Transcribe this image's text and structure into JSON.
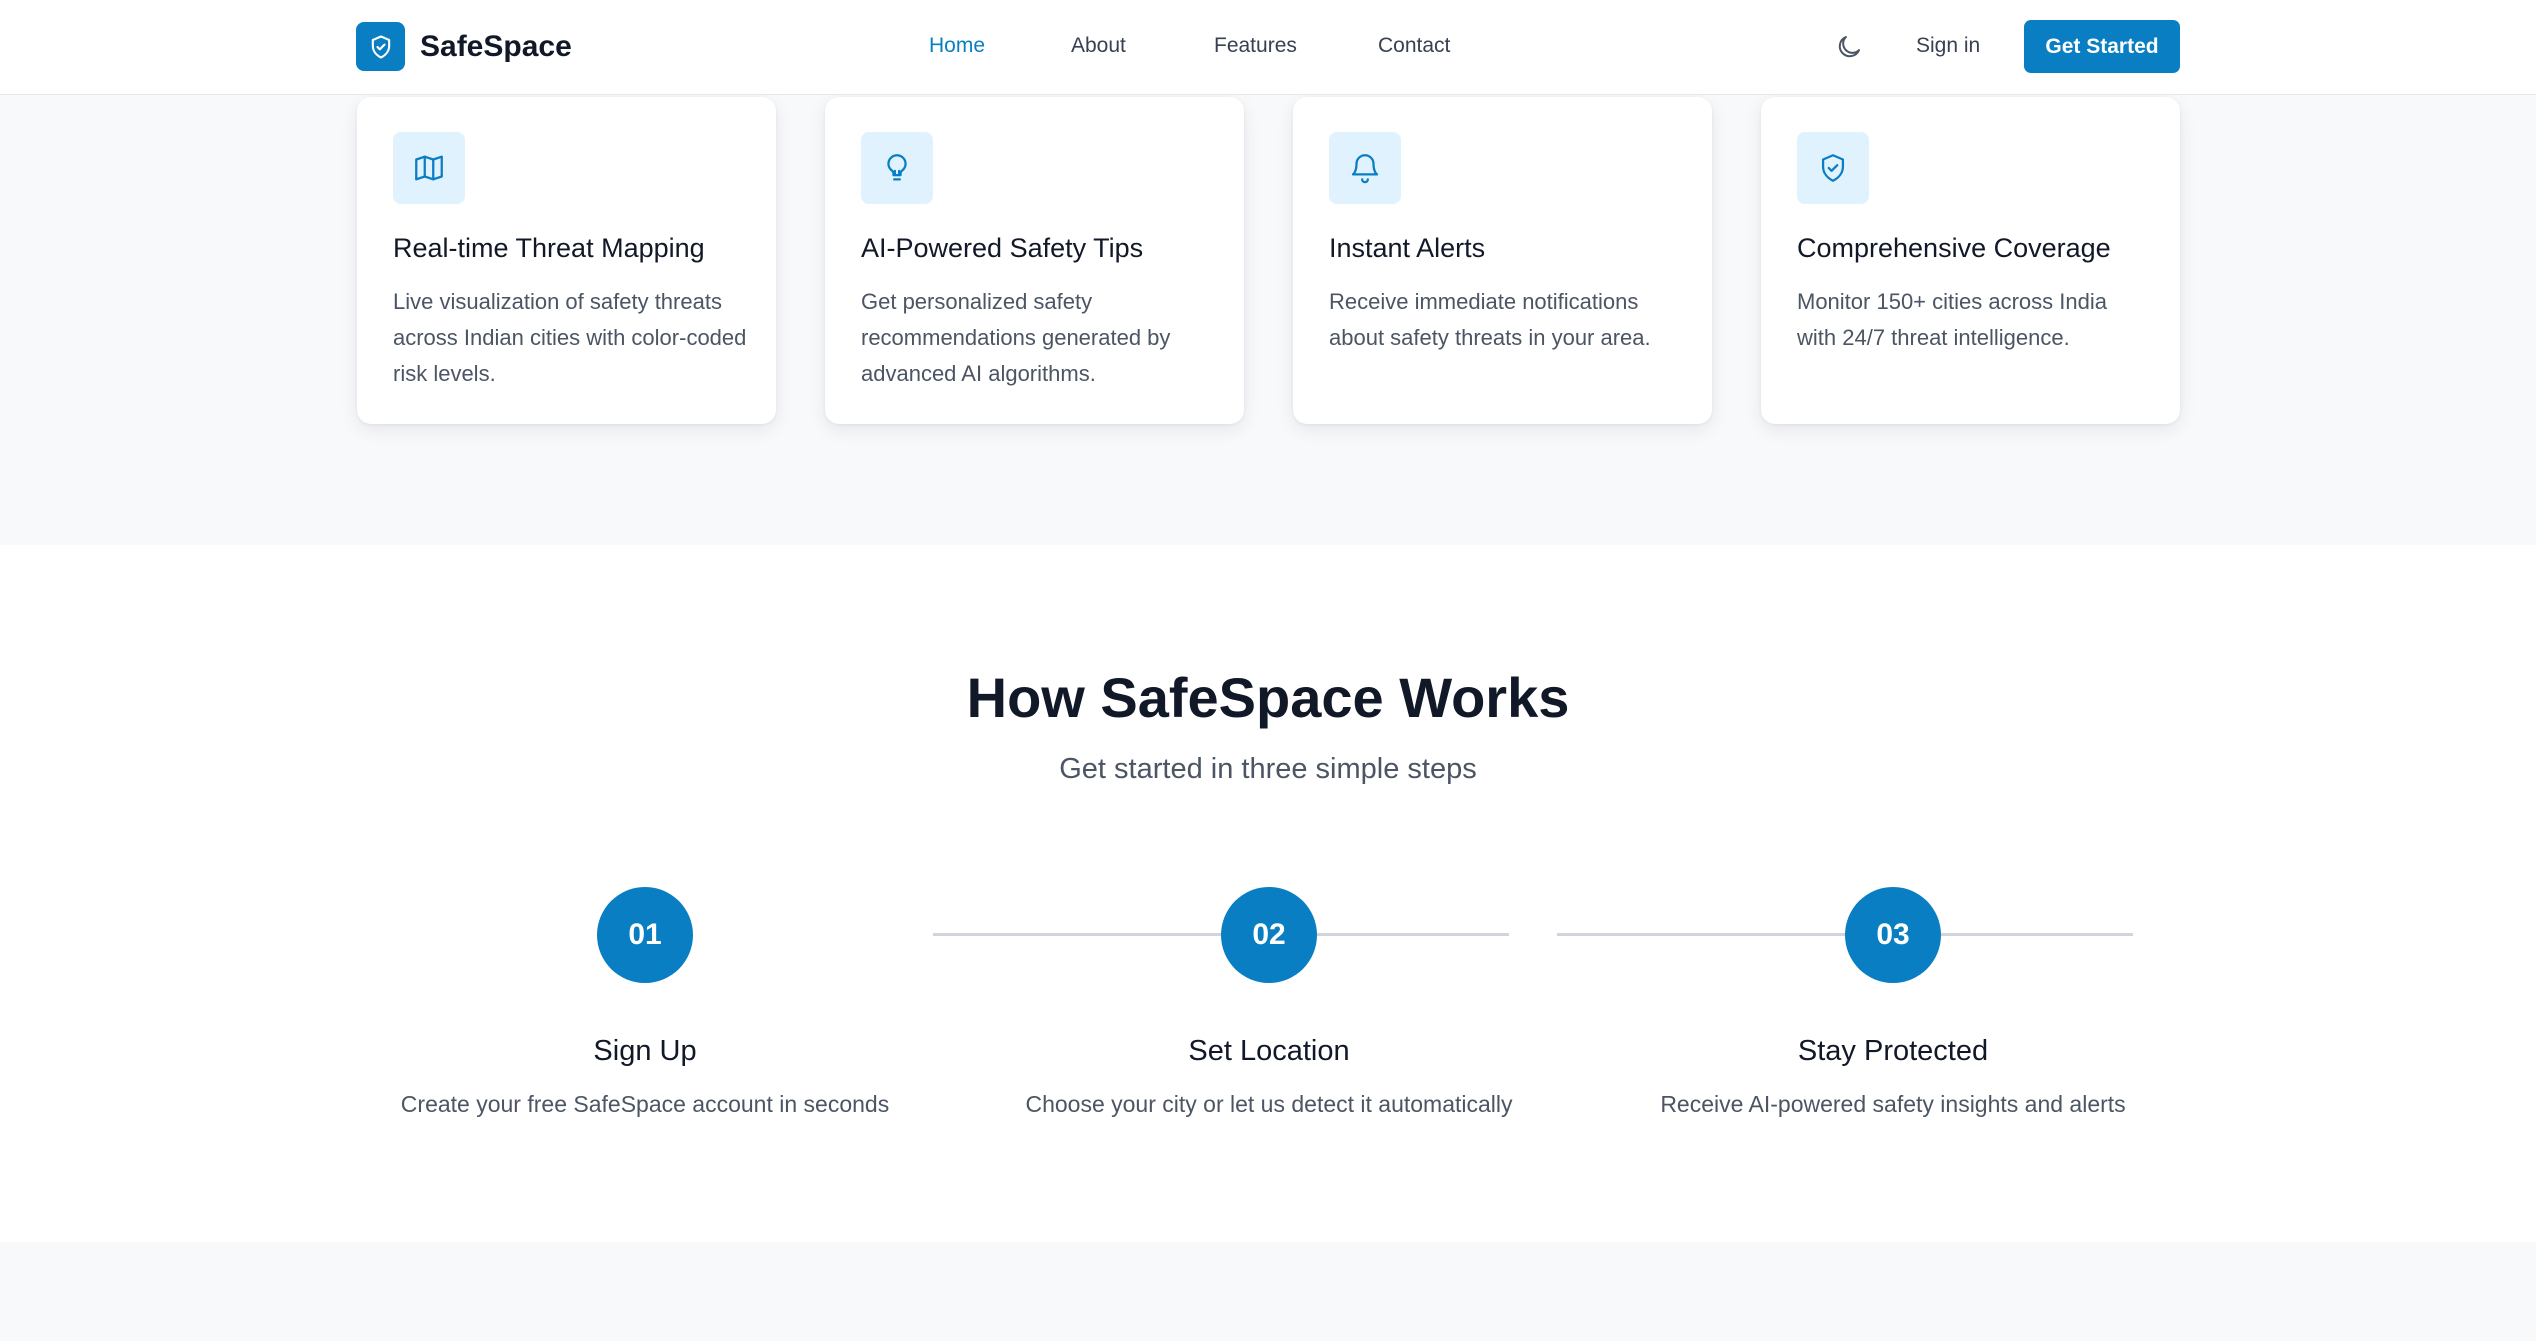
{
  "header": {
    "brand": "SafeSpace",
    "nav": [
      "Home",
      "About",
      "Features",
      "Contact"
    ],
    "active_nav": "Home",
    "theme_icon": "moon-icon",
    "sign_in": "Sign in",
    "get_started": "Get Started"
  },
  "features": [
    {
      "icon": "map-icon",
      "title": "Real-time Threat Mapping",
      "description": "Live visualization of safety threats across Indian cities with color-coded risk levels."
    },
    {
      "icon": "lightbulb-icon",
      "title": "AI-Powered Safety Tips",
      "description": "Get personalized safety recommendations generated by advanced AI algorithms."
    },
    {
      "icon": "bell-icon",
      "title": "Instant Alerts",
      "description": "Receive immediate notifications about safety threats in your area."
    },
    {
      "icon": "shield-check-icon",
      "title": "Comprehensive Coverage",
      "description": "Monitor 150+ cities across India with 24/7 threat intelligence."
    }
  ],
  "how": {
    "title": "How SafeSpace Works",
    "subtitle": "Get started in three simple steps",
    "steps": [
      {
        "number": "01",
        "title": "Sign Up",
        "description": "Create your free SafeSpace account in seconds"
      },
      {
        "number": "02",
        "title": "Set Location",
        "description": "Choose your city or let us detect it automatically"
      },
      {
        "number": "03",
        "title": "Stay Protected",
        "description": "Receive AI-powered safety insights and alerts"
      }
    ]
  },
  "colors": {
    "accent": "#0a7ec2",
    "icon_bg": "#e0f2fe",
    "band_bg": "#f8f9fb"
  }
}
